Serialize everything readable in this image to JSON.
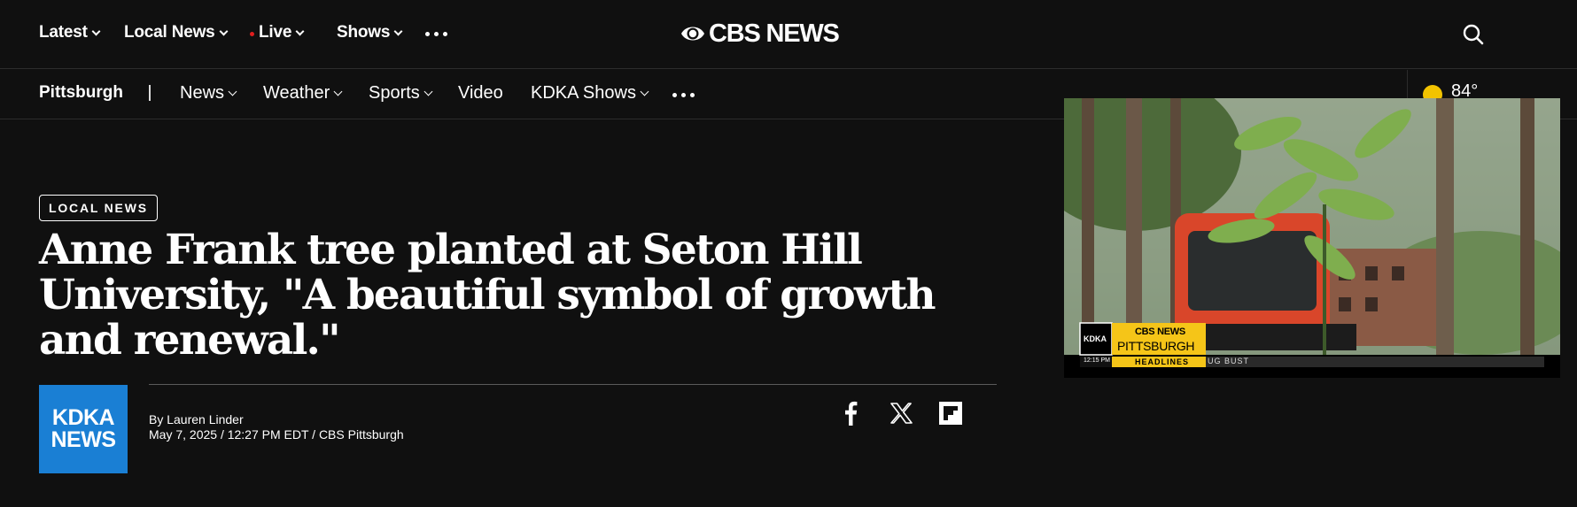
{
  "top_nav": {
    "latest_label": "Latest",
    "local_news_label": "Local News",
    "live_label": "Live",
    "shows_label": "Shows",
    "logo_text": "CBS NEWS"
  },
  "sub_nav": {
    "city": "Pittsburgh",
    "separator": "|",
    "items": [
      "News",
      "Weather",
      "Sports",
      "Video",
      "KDKA Shows"
    ],
    "temperature": "84°"
  },
  "article": {
    "category": "LOCAL NEWS",
    "headline": "Anne Frank tree planted at Seton Hill University, \"A beautiful symbol of growth and renewal.\"",
    "station_logo_line1": "KDKA",
    "station_logo_line2": "NEWS",
    "author": "By Lauren Linder",
    "dateline": "May 7, 2025 / 12:27 PM EDT / CBS Pittsburgh"
  },
  "video": {
    "bug_station": "KDKA",
    "bug_network": "CBS NEWS",
    "bug_city": "PITTSBURGH",
    "bug_time": "12:15 PM",
    "bug_segment": "HEADLINES",
    "ticker_text": "UG BUST"
  },
  "colors": {
    "background": "#101010",
    "kdka_blue": "#1a7fd4",
    "live_red": "#e01e1e",
    "sun_yellow": "#f2c300",
    "bug_yellow": "#f5c518"
  },
  "icons": {
    "search": "search-icon",
    "facebook": "facebook-icon",
    "x": "x-icon",
    "flipboard": "flipboard-icon",
    "weather": "sun-icon",
    "more": "more-dots-icon"
  }
}
